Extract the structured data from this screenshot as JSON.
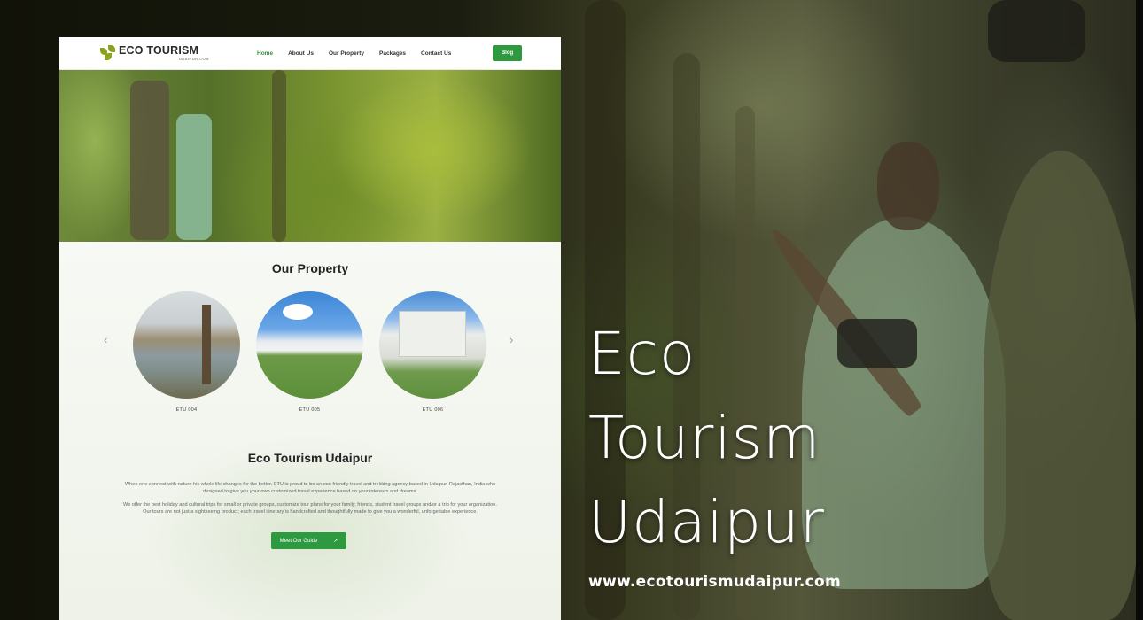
{
  "mockup": {
    "nav": {
      "logo_text": "ECO TOURISM",
      "logo_sub": "UDAIPUR.COM",
      "menu": [
        "Home",
        "About Us",
        "Our Property",
        "Packages",
        "Contact Us"
      ],
      "active_index": 0,
      "blog_label": "Blog"
    },
    "our_property": {
      "title": "Our Property",
      "items": [
        {
          "label": "ETU 004"
        },
        {
          "label": "ETU 005"
        },
        {
          "label": "ETU 006"
        }
      ],
      "prev_icon": "‹",
      "next_icon": "›"
    },
    "about": {
      "title": "Eco Tourism Udaipur",
      "paragraph1": "When one connect with nature his whole life changes for the better. ETU is proud to be an eco friendly travel and trekking agency based in Udaipur, Rajasthan, India who designed to give you your own customized travel experience based on your interests and dreams.",
      "paragraph2": "We offer the best holiday and cultural trips for small or private groups, customize tour plans for your family, friends, student travel groups and/or a trip for your organization. Our tours are not just a sightseeing product; each travel itinerary is handcrafted and thoughtfully made to give you a wonderful, unforgettable experience.",
      "button_label": "Meet Our Guide"
    }
  },
  "hero": {
    "line1": "Eco",
    "line2": "Tourism",
    "line3": "Udaipur",
    "url": "www.ecotourismudaipur.com"
  },
  "colors": {
    "accent": "#2e9a3f",
    "logo_leaf": "#8aa31e"
  }
}
